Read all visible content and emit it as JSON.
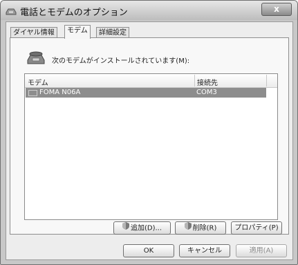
{
  "window": {
    "title": "電話とモデムのオプション",
    "close_label": "x"
  },
  "tabs": [
    {
      "label": "ダイヤル情報",
      "active": false
    },
    {
      "label": "モデム",
      "active": true
    },
    {
      "label": "詳細設定",
      "active": false
    }
  ],
  "panel": {
    "description": "次のモデムがインストールされています(M):",
    "list": {
      "columns": [
        "モデム",
        "接続先"
      ],
      "rows": [
        {
          "name": "FOMA N06A",
          "port": "COM3",
          "selected": true
        }
      ]
    },
    "buttons": {
      "add": "追加(D)...",
      "remove": "削除(R)",
      "properties": "プロパティ(P)"
    }
  },
  "footer": {
    "ok": "OK",
    "cancel": "キャンセル",
    "apply": "適用(A)"
  },
  "icons": {
    "app": "phone-modem-icon",
    "modem": "modem-icon",
    "shield": "shield-icon"
  },
  "colors": {
    "selection": "#8d8d8d",
    "titlebar": "#bdbdbd",
    "dialog": "#ededed"
  }
}
